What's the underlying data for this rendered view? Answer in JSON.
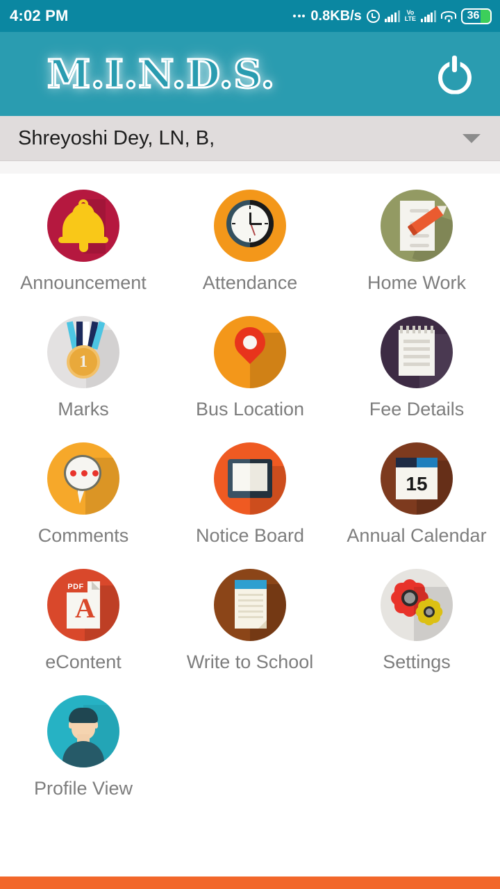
{
  "status_bar": {
    "time": "4:02 PM",
    "data_rate": "0.8KB/s",
    "battery_percent": "36",
    "icons": [
      "alarm-icon",
      "signal-bars-icon",
      "volte-icon",
      "signal-bars-icon",
      "wifi-icon",
      "battery-icon"
    ],
    "volte_top": "Vo",
    "volte_bottom": "LTE",
    "background_color": "#0b87a1"
  },
  "header": {
    "logo_text": "M.I.N.D.S.",
    "power_icon": "power-icon",
    "background_color": "#2a9cb0"
  },
  "student_selector": {
    "selected_value": "Shreyoshi  Dey, LN, B,",
    "caret_icon": "chevron-down-icon",
    "background_color": "#e0dcdc"
  },
  "grid": {
    "items": [
      {
        "label": "Announcement",
        "icon": "bell-icon",
        "color": "#b5183f"
      },
      {
        "label": "Attendance",
        "icon": "clock-icon",
        "color": "#f3971a"
      },
      {
        "label": "Home Work",
        "icon": "notepad-pencil-icon",
        "color": "#939a63"
      },
      {
        "label": "Marks",
        "icon": "medal-icon",
        "color": "#e3e1e1"
      },
      {
        "label": "Bus Location",
        "icon": "map-pin-icon",
        "color": "#f3971a"
      },
      {
        "label": "Fee Details",
        "icon": "notebook-icon",
        "color": "#3d2b44"
      },
      {
        "label": "Comments",
        "icon": "speech-bubble-icon",
        "color": "#f6a82a"
      },
      {
        "label": "Notice Board",
        "icon": "whiteboard-icon",
        "color": "#ef5a22"
      },
      {
        "label": "Annual Calendar",
        "icon": "calendar-icon",
        "color": "#7d3a1e"
      },
      {
        "label": "eContent",
        "icon": "pdf-file-icon",
        "color": "#d9482b"
      },
      {
        "label": "Write to School",
        "icon": "lined-notepad-icon",
        "color": "#8b4518"
      },
      {
        "label": "Settings",
        "icon": "gears-icon",
        "color": "#e6e4e0"
      },
      {
        "label": "Profile View",
        "icon": "person-avatar-icon",
        "color": "#26b2c4"
      }
    ],
    "medal_number": "1",
    "calendar_day": "15",
    "pdf_tag": "PDF",
    "pdf_glyph": "A",
    "label_color": "#7d7d7d"
  },
  "bottom_bar": {
    "color": "#f2672a"
  }
}
